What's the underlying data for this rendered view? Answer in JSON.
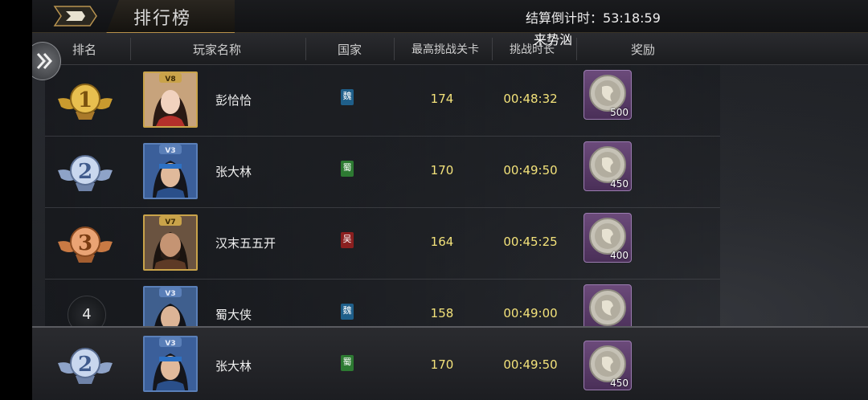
{
  "header": {
    "title": "排行榜",
    "countdown_label": "结算倒计时：",
    "countdown_value": "53:18:59"
  },
  "floating_text": "来势汹",
  "columns": [
    "排名",
    "玩家名称",
    "国家",
    "最高挑战关卡",
    "挑战时长",
    "奖励"
  ],
  "rows": [
    {
      "rank": "1",
      "name": "彭恰恰",
      "nation": "魏",
      "nation_color": "#1f5f8a",
      "stage": "174",
      "time": "00:48:32",
      "reward": "500",
      "frame": "gold",
      "vip": "V8"
    },
    {
      "rank": "2",
      "name": "张大林",
      "nation": "蜀",
      "nation_color": "#2d7a32",
      "stage": "170",
      "time": "00:49:50",
      "reward": "450",
      "frame": "blue",
      "vip": "V3"
    },
    {
      "rank": "3",
      "name": "汉末五五开",
      "nation": "吴",
      "nation_color": "#8a1f1f",
      "stage": "164",
      "time": "00:45:25",
      "reward": "400",
      "frame": "gold",
      "vip": "V7"
    },
    {
      "rank": "4",
      "name": "蜀大侠",
      "nation": "魏",
      "nation_color": "#1f5f8a",
      "stage": "158",
      "time": "00:49:00",
      "reward": "",
      "frame": "blue",
      "vip": "V3"
    }
  ],
  "my_row": {
    "rank": "2",
    "name": "张大林",
    "nation": "蜀",
    "nation_color": "#2d7a32",
    "stage": "170",
    "time": "00:49:50",
    "reward": "450",
    "frame": "blue",
    "vip": "V3"
  },
  "colors": {
    "gold": "#d8b24a",
    "silver": "#a7b9d6",
    "bronze": "#d48a55",
    "value_yellow": "#f3e27a"
  },
  "icons": {
    "back": "back-arrow-icon",
    "toggle": "chevron-double-right-icon",
    "reward": "silver-coin-icon"
  }
}
